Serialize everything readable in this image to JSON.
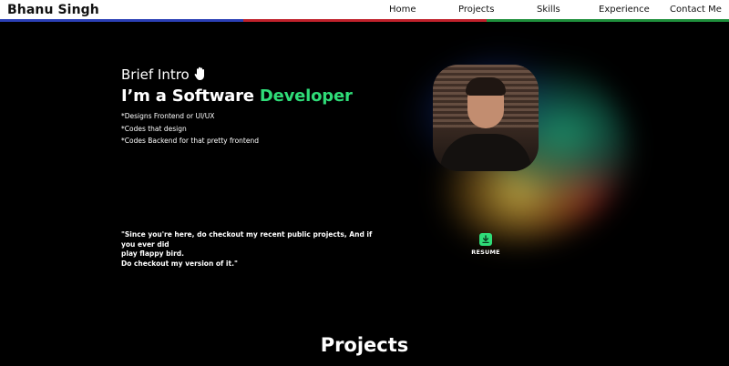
{
  "nav": {
    "brand": "Bhanu Singh",
    "items": [
      {
        "label": "Home"
      },
      {
        "label": "Projects"
      },
      {
        "label": "Skills"
      },
      {
        "label": "Experience"
      },
      {
        "label": "Contact Me"
      }
    ],
    "stripe_colors": [
      "#2b3fb5",
      "#c0212b",
      "#1f8f3c"
    ]
  },
  "hero": {
    "intro": "Brief Intro",
    "headline_prefix": "I’m a Software ",
    "headline_accent": "Developer",
    "bullets": [
      "*Designs Frontend or UI/UX",
      "*Codes that design",
      "*Codes Backend for that pretty frontend"
    ],
    "quote_lines": [
      "\"Since you're here, do checkout my recent public projects, And if you ever did",
      "play flappy bird.",
      "Do checkout my version of it.\""
    ],
    "resume_label": "RESUME",
    "accent_color": "#2fdc78"
  },
  "projects": {
    "title": "Projects"
  }
}
